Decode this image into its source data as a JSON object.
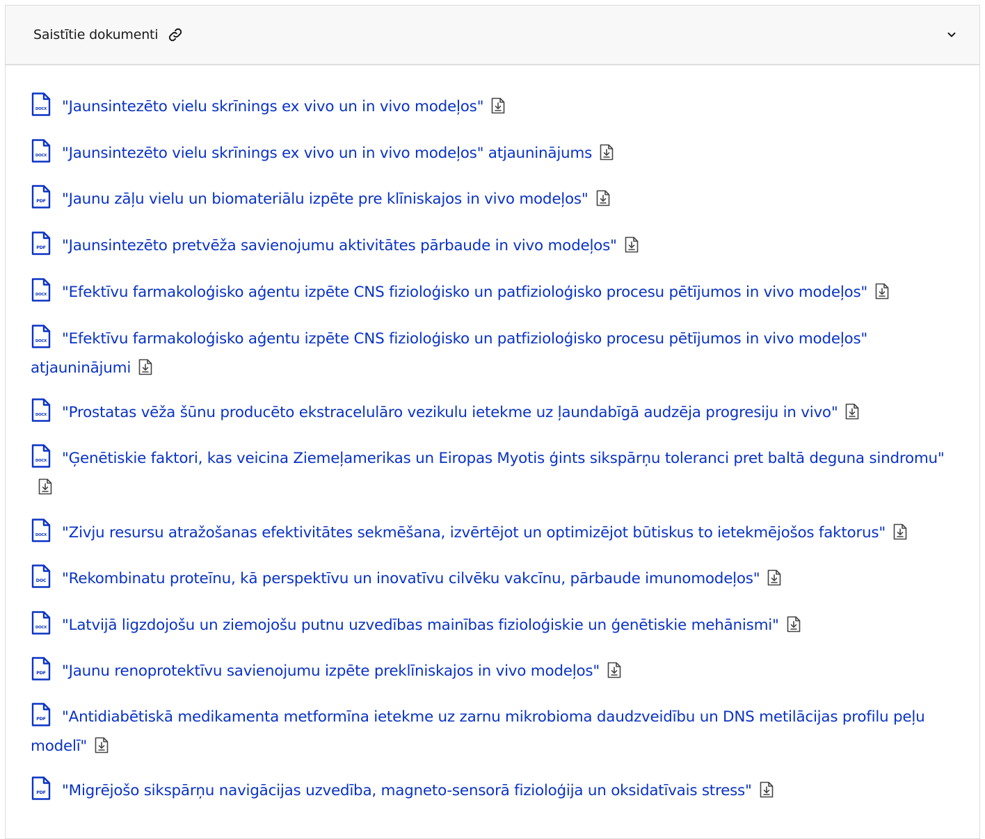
{
  "panel": {
    "title": "Saistītie dokumenti",
    "link_icon": "link-icon",
    "toggle_icon": "chevron-down-icon"
  },
  "colors": {
    "link": "#0a33c4",
    "header_bg": "#f8f8f8",
    "border": "#dcdcdc"
  },
  "documents": [
    {
      "type": "DOCX",
      "title": "\"Jaunsintezēto vielu skrīnings ex vivo un in vivo modeļos\""
    },
    {
      "type": "DOCX",
      "title": "\"Jaunsintezēto vielu skrīnings ex vivo un in vivo modeļos\" atjauninājums"
    },
    {
      "type": "PDF",
      "title": "\"Jaunu zāļu vielu un biomateriālu izpēte pre klīniskajos in vivo modeļos\""
    },
    {
      "type": "PDF",
      "title": "\"Jaunsintezēto pretvēža savienojumu aktivitātes pārbaude in vivo modeļos\""
    },
    {
      "type": "DOCX",
      "title": "\"Efektīvu farmakoloģisko aģentu izpēte CNS fizioloģisko un patfizioloģisko procesu pētījumos in vivo modeļos\""
    },
    {
      "type": "DOCX",
      "title": "\"Efektīvu farmakoloģisko aģentu izpēte CNS fizioloģisko un patfizioloģisko procesu pētījumos in vivo modeļos\" atjauninājumi"
    },
    {
      "type": "DOCX",
      "title": "\"Prostatas vēža šūnu producēto ekstracelulāro vezikulu ietekme uz ļaundabīgā audzēja progresiju in vivo\""
    },
    {
      "type": "DOCX",
      "title": "\"Ģenētiskie faktori, kas veicina Ziemeļamerikas un Eiropas Myotis ģints sikspārņu toleranci pret baltā deguna sindromu\""
    },
    {
      "type": "DOCX",
      "title": "\"Zivju resursu atražošanas efektivitātes sekmēšana, izvērtējot un optimizējot būtiskus to ietekmējošos faktorus\""
    },
    {
      "type": "DOC",
      "title": "\"Rekombinatu proteīnu, kā perspektīvu un inovatīvu cilvēku vakcīnu, pārbaude imunomodeļos\""
    },
    {
      "type": "DOCX",
      "title": "\"Latvijā ligzdojošu un ziemojošu putnu uzvedības mainības fizioloģiskie un ģenētiskie mehānismi\""
    },
    {
      "type": "PDF",
      "title": "\"Jaunu renoprotektīvu savienojumu izpēte preklīniskajos in vivo modeļos\""
    },
    {
      "type": "PDF",
      "title": "\"Antidiabētiskā medikamenta metformīna ietekme uz zarnu mikrobioma daudzveidību un DNS metilācijas profilu peļu modelī\""
    },
    {
      "type": "PDF",
      "title": "\"Migrējošo sikspārņu navigācijas uzvedība, magneto-sensorā fizioloģija un oksidatīvais stress\""
    }
  ]
}
